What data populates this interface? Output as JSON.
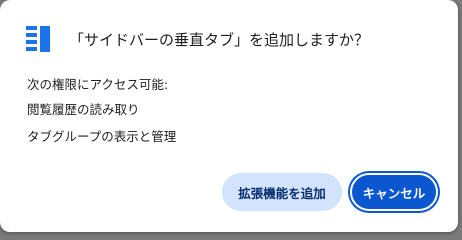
{
  "dialog": {
    "title": "「サイドバーの垂直タブ」を追加しますか？",
    "icon": "vertical-tabs-sidebar-icon",
    "permissions_heading": "次の権限にアクセス可能:",
    "permissions": [
      "閲覧履歴の読み取り",
      "タブグループの表示と管理"
    ],
    "buttons": {
      "add_label": "拡張機能を追加",
      "cancel_label": "キャンセル"
    }
  },
  "colors": {
    "accent": "#0b57d0",
    "icon": "#1a73e8",
    "tonal_button": "#d3e3fd"
  }
}
